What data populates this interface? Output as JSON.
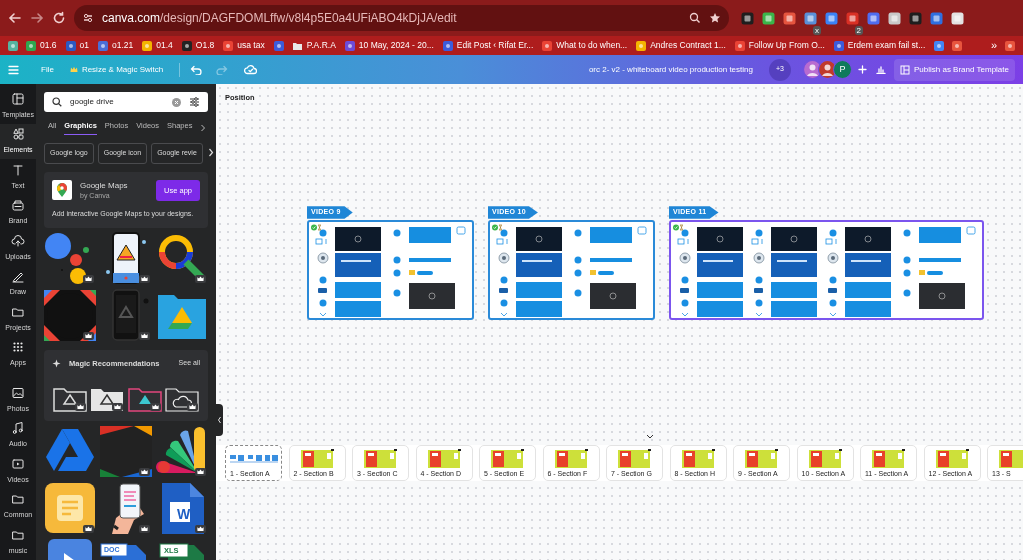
{
  "browser": {
    "address": {
      "host": "canva.com",
      "path": "/design/DAGFDOMLffw/v8l4p5E0a4UFiABO4kDjJA/edit"
    },
    "extensions": [
      {
        "color": "#1e1e1e"
      },
      {
        "color": "#3bb54a"
      },
      {
        "color": "#e5553f"
      },
      {
        "color": "#5a8fd8",
        "badge": "x"
      },
      {
        "color": "#3b82f6"
      },
      {
        "color": "#d93025",
        "badge": "2"
      },
      {
        "color": "#4f6cf0"
      },
      {
        "color": "#c9c9c9"
      },
      {
        "color": "#1e1e1e"
      },
      {
        "color": "#2f6fe0"
      },
      {
        "color": "#e3e3e3"
      }
    ],
    "bookmarks": [
      {
        "kind": "site",
        "color": "#56b3a0"
      },
      {
        "kind": "site",
        "label": "01.6",
        "color": "#2fa84f"
      },
      {
        "kind": "site",
        "label": "o1",
        "color": "#2b59c3"
      },
      {
        "kind": "site",
        "label": "o1.21",
        "color": "#4b6ed6"
      },
      {
        "kind": "site",
        "label": "01.4",
        "color": "#f4b400"
      },
      {
        "kind": "site",
        "label": "O1.8",
        "color": "#222222"
      },
      {
        "kind": "site",
        "label": "usa tax",
        "color": "#ea4335"
      },
      {
        "kind": "site",
        "color": "#3b5bdb"
      },
      {
        "kind": "folder",
        "label": "P.A.R.A",
        "color": "#e8e8e8"
      },
      {
        "kind": "site",
        "label": "10 May, 2024 - 20...",
        "color": "#6c4bd8"
      },
      {
        "kind": "site",
        "label": "Edit Post ‹ Rifat Er...",
        "color": "#3b5bdb"
      },
      {
        "kind": "site",
        "label": "What to do when...",
        "color": "#ea4335"
      },
      {
        "kind": "site",
        "label": "Andres Contract 1...",
        "color": "#f4b400"
      },
      {
        "kind": "site",
        "label": "Follow Up From O...",
        "color": "#ea4335"
      },
      {
        "kind": "site",
        "label": "Erdem exam fail st...",
        "color": "#3b5bdb"
      }
    ],
    "more": "»",
    "trailing": [
      {
        "kind": "site",
        "color": "#4285f4"
      },
      {
        "kind": "site",
        "color": "#e8553e"
      }
    ]
  },
  "editor_bar": {
    "file": "File",
    "resize": "Resize & Magic Switch",
    "redo_disabled": true,
    "title": "orc 2- v2 - whiteboard video production testing",
    "more_people": "+3",
    "avatars": [
      {
        "kind": "picture",
        "color": "#b86bd0"
      },
      {
        "kind": "picture",
        "color": "#c0392b"
      },
      {
        "kind": "letter",
        "letter": "P",
        "color": "#0f7a5c"
      }
    ],
    "publish": "Publish as Brand Template"
  },
  "rail": [
    {
      "kind": "templates",
      "label": "Templates",
      "selected": false
    },
    {
      "kind": "elements",
      "label": "Elements",
      "selected": true
    },
    {
      "kind": "text",
      "label": "Text",
      "selected": false
    },
    {
      "kind": "brand",
      "label": "Brand",
      "selected": false
    },
    {
      "kind": "uploads",
      "label": "Uploads",
      "selected": false
    },
    {
      "kind": "draw",
      "label": "Draw",
      "selected": false
    },
    {
      "kind": "folder",
      "label": "Projects",
      "selected": false
    },
    {
      "kind": "apps",
      "label": "Apps",
      "selected": false
    },
    {
      "kind": "photos",
      "label": "Photos",
      "selected": false
    },
    {
      "kind": "audio",
      "label": "Audio",
      "selected": false
    },
    {
      "kind": "videos",
      "label": "Videos",
      "selected": false
    },
    {
      "kind": "folder",
      "label": "Common",
      "selected": false
    },
    {
      "kind": "folder",
      "label": "music",
      "selected": false
    }
  ],
  "panel": {
    "search": {
      "value": "google drive"
    },
    "tabs": [
      {
        "label": "All",
        "selected": false
      },
      {
        "label": "Graphics",
        "selected": true
      },
      {
        "label": "Photos",
        "selected": false
      },
      {
        "label": "Videos",
        "selected": false
      },
      {
        "label": "Shapes",
        "selected": false
      }
    ],
    "chips": [
      "Google logo",
      "Google icon",
      "Google revie"
    ],
    "app": {
      "name": "Google Maps",
      "by": "by Canva",
      "button": "Use app",
      "description": "Add interactive Google Maps to your designs."
    },
    "graphics": [
      {
        "kind": "dots",
        "premium": true
      },
      {
        "kind": "phone-drive",
        "premium": true
      },
      {
        "kind": "magnifier",
        "premium": true
      },
      {
        "kind": "corner-frame",
        "premium": true
      },
      {
        "kind": "phone-dark",
        "premium": true
      },
      {
        "kind": "folder-drive",
        "premium": false
      }
    ],
    "magic": {
      "title": "Magic Recommendations",
      "see_all": "See all",
      "items": [
        {
          "kind": "folder-outline",
          "premium": true
        },
        {
          "kind": "folder-grey",
          "premium": true
        },
        {
          "kind": "folder-pink",
          "premium": true
        },
        {
          "kind": "folder-cloud",
          "premium": true
        }
      ]
    },
    "more_graphics": [
      {
        "kind": "drive-logo",
        "premium": false
      },
      {
        "kind": "stripes",
        "premium": true
      },
      {
        "kind": "fan",
        "premium": true
      },
      {
        "kind": "notes",
        "premium": true
      },
      {
        "kind": "hand-phone",
        "premium": true
      },
      {
        "kind": "word-file",
        "premium": true,
        "text": "W"
      },
      {
        "kind": "doc-blue",
        "premium": false
      },
      {
        "kind": "doc-label",
        "premium": false,
        "text": "DOC"
      },
      {
        "kind": "xls-file",
        "premium": false,
        "text": "XLS"
      }
    ]
  },
  "canvas": {
    "position_label": "Position",
    "boards": [
      {
        "label": "VIDEO 9",
        "selected": false,
        "columns": [
          {
            "kind": "clips"
          },
          {
            "kind": "steps"
          }
        ]
      },
      {
        "label": "VIDEO 10",
        "selected": false,
        "columns": [
          {
            "kind": "clips"
          },
          {
            "kind": "steps"
          }
        ]
      },
      {
        "label": "VIDEO 11",
        "selected": true,
        "columns": [
          {
            "kind": "clips"
          },
          {
            "kind": "clips"
          },
          {
            "kind": "clips"
          },
          {
            "kind": "steps"
          }
        ]
      }
    ],
    "pages": [
      {
        "label": "1 - Section A",
        "kind": "whiteboard",
        "selected": true
      },
      {
        "label": "2 - Section B",
        "kind": "slide",
        "selected": false
      },
      {
        "label": "3 - Section C",
        "kind": "slide",
        "selected": false
      },
      {
        "label": "4 - Section D",
        "kind": "slide",
        "selected": false
      },
      {
        "label": "5 - Section E",
        "kind": "slide",
        "selected": false
      },
      {
        "label": "6 - Section F",
        "kind": "slide",
        "selected": false
      },
      {
        "label": "7 - Section G",
        "kind": "slide",
        "selected": false
      },
      {
        "label": "8 - Section H",
        "kind": "slide",
        "selected": false
      },
      {
        "label": "9 - Section A",
        "kind": "slide",
        "selected": false
      },
      {
        "label": "10 - Section A",
        "kind": "slide",
        "selected": false
      },
      {
        "label": "11 - Section A",
        "kind": "slide",
        "selected": false
      },
      {
        "label": "12 - Section A",
        "kind": "slide",
        "selected": false
      },
      {
        "label": "13 - S",
        "kind": "slide",
        "selected": false
      }
    ]
  }
}
